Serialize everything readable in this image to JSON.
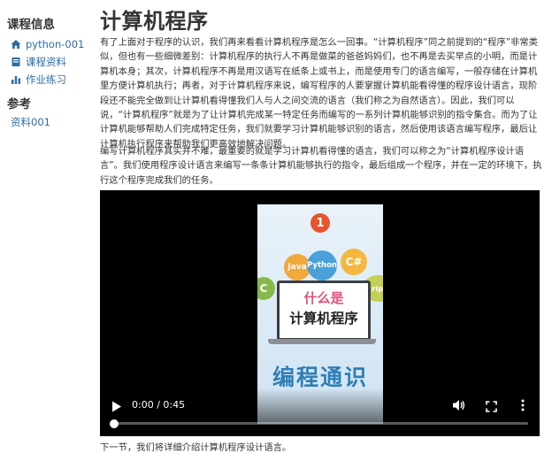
{
  "sidebar": {
    "course_heading": "课程信息",
    "course_items": [
      {
        "label": "python-001",
        "icon": "home-icon"
      },
      {
        "label": "课程资料",
        "icon": "book-icon"
      },
      {
        "label": "作业练习",
        "icon": "bar-chart-icon"
      }
    ],
    "ref_heading": "参考",
    "ref_items": [
      {
        "label": "资料001"
      }
    ]
  },
  "main": {
    "title": "计算机程序",
    "paragraph1": "有了上面对于程序的认识，我们再来看看计算机程序是怎么一回事。“计算机程序”同之前提到的“程序”非常类似，但也有一些细微差别：计算机程序的执行人不再是做菜的爸爸妈妈们，也不再是去买早点的小明，而是计算机本身；其次，计算机程序不再是用汉语写在纸条上或书上，而是使用专门的语言编写，一般存储在计算机里方便计算机执行；再者，对于计算机程序来说，编写程序的人要掌握计算机能看得懂的程序设计语言，现阶段还不能完全做到让计算机看得懂我们人与人之间交流的语言（我们称之为自然语言）。因此，我们可以说，“计算机程序”就是为了让计算机完成某一特定任务而编写的一系列计算机能够识别的指令集合。而为了让计算机能够帮助人们完成特定任务，我们就要学习计算机能够识别的语言，然后使用该语言编写程序，最后让计算机执行程序来帮助我们更高效地解决问题。",
    "paragraph2": "编写计算机程序其实并不难，最重要的就是学习计算机看得懂的语言，我们可以称之为“计算机程序设计语言”。我们使用程序设计语言来编写一条条计算机能够执行的指令，最后组成一个程序，并在一定的环境下，执行这个程序完成我们的任务。",
    "next_text": "下一节，我们将详细介绍计算机程序设计语言。"
  },
  "video": {
    "thumbnail": {
      "number": "1",
      "bubbles": [
        "Java",
        "Python",
        "C#",
        "C",
        "script"
      ],
      "line1": "什么是",
      "line2": "计算机程序",
      "caption": "编程通识"
    },
    "time_display": "0:00 / 0:45",
    "progress": 0,
    "controls": [
      "play-icon",
      "volume-icon",
      "fullscreen-icon",
      "more-vert-icon"
    ]
  },
  "colors": {
    "link": "#2e6da4",
    "text": "#333333",
    "video_bg": "#000000",
    "badge": "#e8542c",
    "caption": "#2f7fb5"
  }
}
